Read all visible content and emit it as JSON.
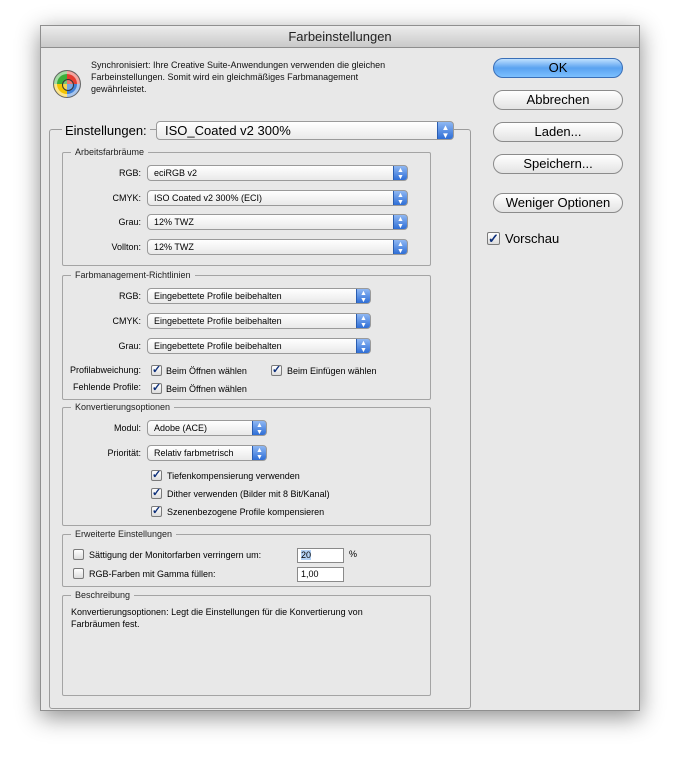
{
  "window": {
    "title": "Farbeinstellungen"
  },
  "sync_text": "Synchronisiert: Ihre Creative Suite-Anwendungen verwenden die gleichen Farbeinstellungen. Somit wird ein gleichmäßiges Farbmanagement gewährleistet.",
  "settings": {
    "label": "Einstellungen:",
    "value": "ISO_Coated v2 300%"
  },
  "arbeitsfarbraeume": {
    "legend": "Arbeitsfarbräume",
    "rgb_label": "RGB:",
    "rgb_value": "eciRGB v2",
    "cmyk_label": "CMYK:",
    "cmyk_value": "ISO Coated v2 300% (ECI)",
    "grau_label": "Grau:",
    "grau_value": "12% TWZ",
    "vollton_label": "Vollton:",
    "vollton_value": "12% TWZ"
  },
  "richtlinien": {
    "legend": "Farbmanagement-Richtlinien",
    "rgb_label": "RGB:",
    "rgb_value": "Eingebettete Profile beibehalten",
    "cmyk_label": "CMYK:",
    "cmyk_value": "Eingebettete Profile beibehalten",
    "grau_label": "Grau:",
    "grau_value": "Eingebettete Profile beibehalten",
    "profil_label": "Profilabweichung:",
    "profil_open": "Beim Öffnen wählen",
    "profil_paste": "Beim Einfügen wählen",
    "fehlend_label": "Fehlende Profile:",
    "fehlend_open": "Beim Öffnen wählen"
  },
  "konvertierung": {
    "legend": "Konvertierungsoptionen",
    "modul_label": "Modul:",
    "modul_value": "Adobe (ACE)",
    "prioritaet_label": "Priorität:",
    "prioritaet_value": "Relativ farbmetrisch",
    "tiefen": "Tiefenkompensierung verwenden",
    "dither": "Dither verwenden (Bilder mit 8 Bit/Kanal)",
    "szenen": "Szenenbezogene Profile kompensieren"
  },
  "erweitert": {
    "legend": "Erweiterte Einstellungen",
    "saettigung": "Sättigung der Monitorfarben verringern um:",
    "saettigung_value": "20",
    "saettigung_unit": "%",
    "gamma": "RGB-Farben mit Gamma füllen:",
    "gamma_value": "1,00"
  },
  "beschreibung": {
    "legend": "Beschreibung",
    "text": "Konvertierungsoptionen: Legt die Einstellungen für die Konvertierung von Farbräumen fest."
  },
  "buttons": {
    "ok": "OK",
    "abbrechen": "Abbrechen",
    "laden": "Laden...",
    "speichern": "Speichern...",
    "weniger": "Weniger Optionen"
  },
  "vorschau": {
    "label": "Vorschau",
    "checked": true
  },
  "colors": {
    "accent": "#3e7fd6",
    "window_bg": "#e8e8e8"
  }
}
